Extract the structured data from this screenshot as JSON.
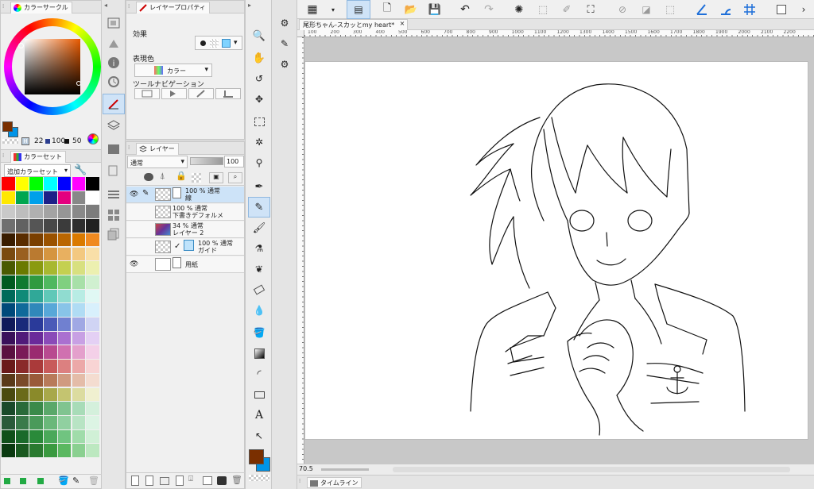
{
  "colorCircle": {
    "tab": "カラーサークル",
    "hue": "22",
    "saturation": "100",
    "value": "50",
    "indicator": "H"
  },
  "colorSet": {
    "tab": "カラーセット",
    "dropdown": "追加カラーセット"
  },
  "layerProperty": {
    "tab": "レイヤープロパティ",
    "effectLabel": "効果",
    "displayColorLabel": "表現色",
    "displayColorValue": "カラー",
    "toolNavLabel": "ツールナビゲーション"
  },
  "layers": {
    "tab": "レイヤー",
    "blendMode": "通常",
    "opacity": "100",
    "rows": [
      {
        "line1": "100 % 通常",
        "line2": "線"
      },
      {
        "line1": "100 % 通常",
        "line2": "下書きデフォルメ"
      },
      {
        "line1": "34 % 通常",
        "line2": "レイヤー 2"
      },
      {
        "line1": "100 % 通常",
        "line2": "ガイド"
      },
      {
        "line1": "",
        "line2": "用紙"
      }
    ]
  },
  "document": {
    "tab": "尾形ちゃん-スカッとmy heart*",
    "close": "×",
    "zoom": "70.5"
  },
  "timeline": {
    "label": "タイムライン"
  },
  "ruler": [
    "100",
    "200",
    "300",
    "400",
    "500",
    "600",
    "700",
    "800",
    "900",
    "1000",
    "1100",
    "1200",
    "1300",
    "1400",
    "1500",
    "1600",
    "1700",
    "1800",
    "1900",
    "2000",
    "2100",
    "2200"
  ],
  "colors": {
    "main": "#7a2f00",
    "sub": "#0094e8",
    "accent": "#1e6fd9"
  }
}
